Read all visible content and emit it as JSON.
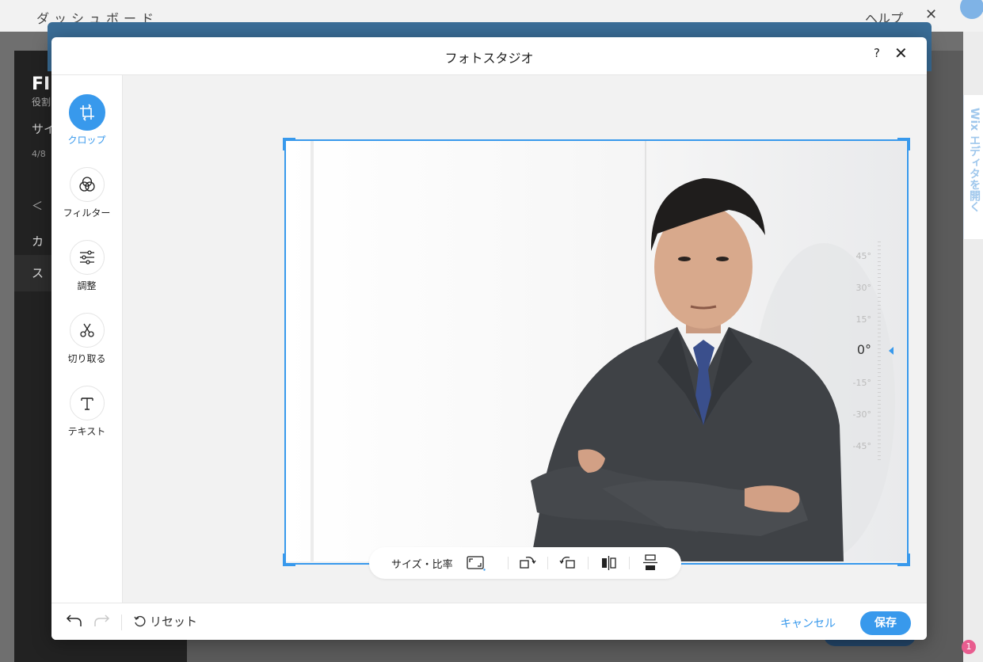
{
  "background": {
    "topbar_title": "ダッシュボード",
    "help_label": "ヘルプ",
    "sidebar_site_short": "FI",
    "sidebar_role": "役割",
    "sidebar_section": "サイ",
    "sidebar_progress": "4/8",
    "sidebar_back": "＜",
    "sidebar_item_1": "カ",
    "sidebar_item_2": "ス",
    "editor_tab": "Wix エディタを開く",
    "notification_count": "1"
  },
  "modal": {
    "title": "フォトスタジオ",
    "help_label": "?",
    "close_label": "✕"
  },
  "tools": [
    {
      "label": "クロップ",
      "icon": "crop-rotate-icon",
      "active": true
    },
    {
      "label": "フィルター",
      "icon": "filter-circles-icon",
      "active": false
    },
    {
      "label": "調整",
      "icon": "sliders-icon",
      "active": false
    },
    {
      "label": "切り取る",
      "icon": "scissors-icon",
      "active": false
    },
    {
      "label": "テキスト",
      "icon": "text-t-icon",
      "active": false
    }
  ],
  "rotation_dial": {
    "labels": [
      "45°",
      "30°",
      "15°",
      "0°",
      "-15°",
      "-30°",
      "-45°"
    ],
    "current_degrees": 0
  },
  "crop_toolbar": {
    "size_ratio_label": "サイズ・比率",
    "icons": [
      "aspect-ratio-icon",
      "rotate-right-icon",
      "rotate-left-icon",
      "flip-horizontal-icon",
      "flip-vertical-icon"
    ]
  },
  "footer": {
    "reset_label": "リセット",
    "cancel_label": "キャンセル",
    "save_label": "保存"
  },
  "colors": {
    "accent": "#3899ec"
  }
}
